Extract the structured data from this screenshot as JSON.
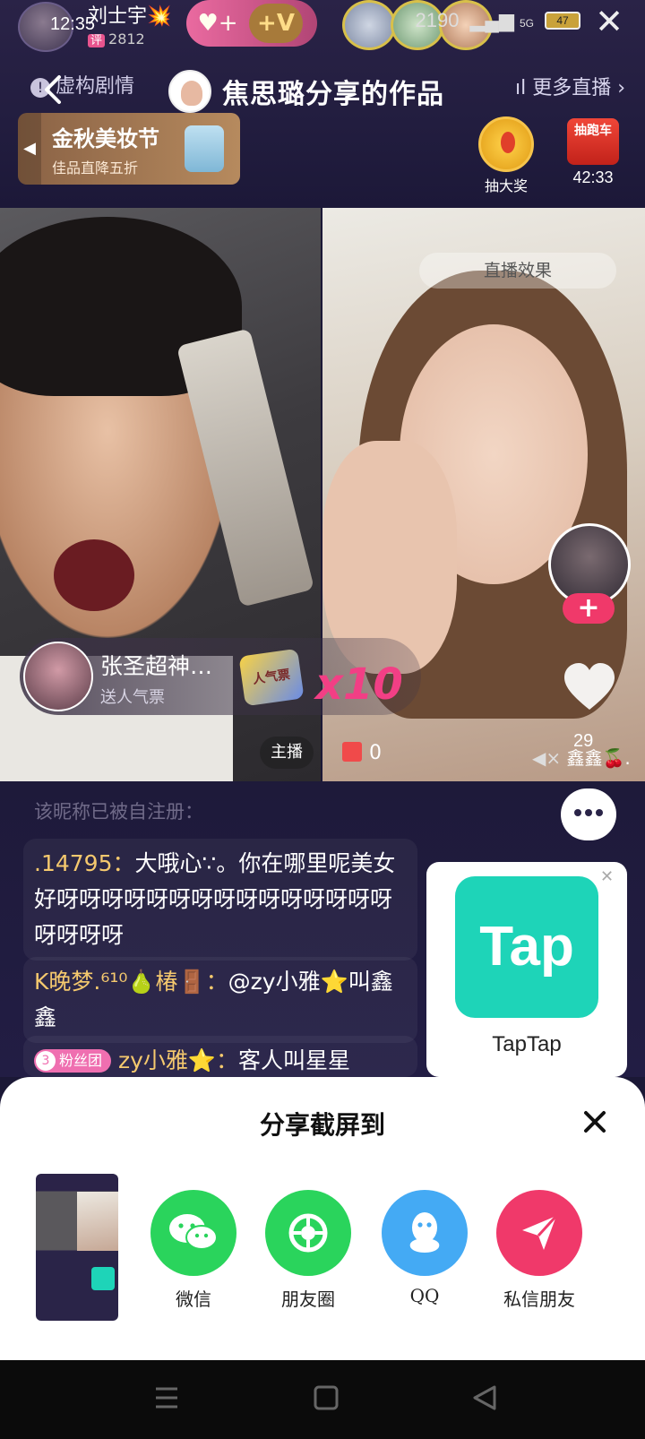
{
  "status": {
    "time": "12:35",
    "battery": "47",
    "signal": "5G"
  },
  "host": {
    "name": "刘士宇💥",
    "sub": "2812",
    "badge": "评"
  },
  "header": {
    "fiction_tag": "虚构剧情",
    "work_title": "焦思璐分享的作品",
    "more_live": "更多直播",
    "viewer_count": "2190"
  },
  "promo": {
    "title": "金秋美妆节",
    "subtitle": "佳品直降五折"
  },
  "lottery": {
    "label": "抽大奖"
  },
  "raffle": {
    "box_label": "抽跑车",
    "timer": "42:33"
  },
  "video": {
    "effect_label": "直播效果",
    "anchor_label": "主播",
    "gift_counter": "0",
    "like_count": "29",
    "right_name": "鑫鑫🍒."
  },
  "gift_banner": {
    "user": "张圣超神…",
    "desc": "送人气票",
    "gift_name": "人气票",
    "count": "x10"
  },
  "chat": {
    "faded": "该昵称已被自注册：",
    "messages": [
      {
        "user": ".14795：",
        "text": "大哦心∵。你在哪里呢美女好呀呀呀呀呀呀呀呀呀呀呀呀呀呀呀呀呀呀呀"
      },
      {
        "user": "K晚梦.⁶¹⁰🍐椿🚪：",
        "text": "@zy小雅⭐叫鑫鑫"
      },
      {
        "badge_level": "3",
        "badge_label": "粉丝团",
        "user": "zy小雅⭐：",
        "text": "客人叫星星"
      }
    ]
  },
  "ad": {
    "logo_text": "Tap",
    "name": "TapTap"
  },
  "share": {
    "title": "分享截屏到",
    "targets": [
      {
        "label": "微信",
        "color": "#2ad45c",
        "icon": "wechat-icon"
      },
      {
        "label": "朋友圈",
        "color": "#2ad45c",
        "icon": "moments-icon"
      },
      {
        "label": "QQ",
        "color": "#44aaf4",
        "icon": "qq-icon"
      },
      {
        "label": "私信朋友",
        "color": "#f0396a",
        "icon": "send-icon"
      }
    ]
  }
}
